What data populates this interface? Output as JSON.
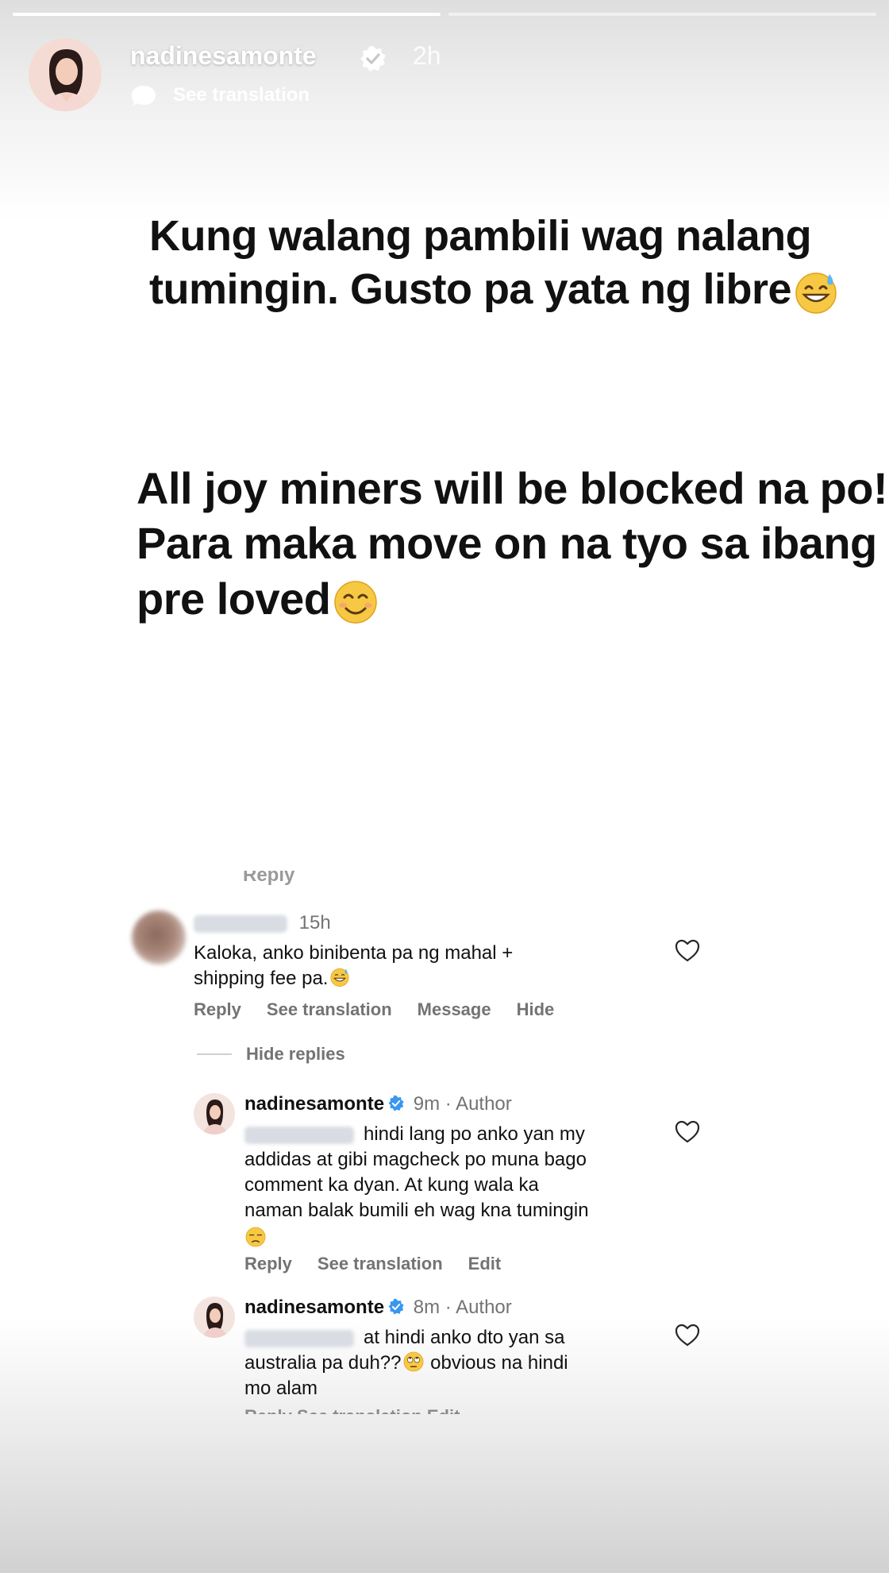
{
  "progress": [
    {
      "label": "story-1",
      "fill_fraction": 1.0
    },
    {
      "label": "story-2",
      "fill_fraction": 0.0
    }
  ],
  "header": {
    "username": "nadinesamonte",
    "time": "2h",
    "see_translation": "See translation"
  },
  "story": {
    "text_block_1": {
      "line1": "Kung walang pambili wag nalang",
      "line2": "tumingin. Gusto pa yata ng libre",
      "emoji": "grinning-sweat-emoji"
    },
    "text_block_2": {
      "line1": "All joy miners will be blocked na po!",
      "line2": "Para maka move on na tyo sa ibang",
      "line3": "pre loved",
      "emoji": "smiling-emoji"
    }
  },
  "comments": {
    "top_cut_label": "Reply",
    "first": {
      "time": "15h",
      "line1": "Kaloka, anko binibenta pa ng mahal +",
      "line2": "shipping fee pa.",
      "actions": [
        "Reply",
        "See translation",
        "Message",
        "Hide"
      ]
    },
    "hide_replies": "Hide replies",
    "reply1": {
      "username": "nadinesamonte",
      "meta": "9m · Author",
      "line1": "hindi lang po anko yan my",
      "line2": "addidas at gibi magcheck po muna bago",
      "line3": "comment ka dyan. At kung wala ka",
      "line4": "naman balak bumili eh wag kna tumingin",
      "actions": [
        "Reply",
        "See translation",
        "Edit"
      ]
    },
    "reply2": {
      "username": "nadinesamonte",
      "meta": "8m · Author",
      "line1": "at hindi anko dto yan sa",
      "line2": "australia pa duh??",
      "line2b": "obvious na hindi",
      "line3": "mo alam",
      "cut_actions": "Reply   See translation   Edit"
    }
  },
  "colors": {
    "muted": "#737373",
    "verified_blue": "#3897f0",
    "story_text": "#111111"
  }
}
